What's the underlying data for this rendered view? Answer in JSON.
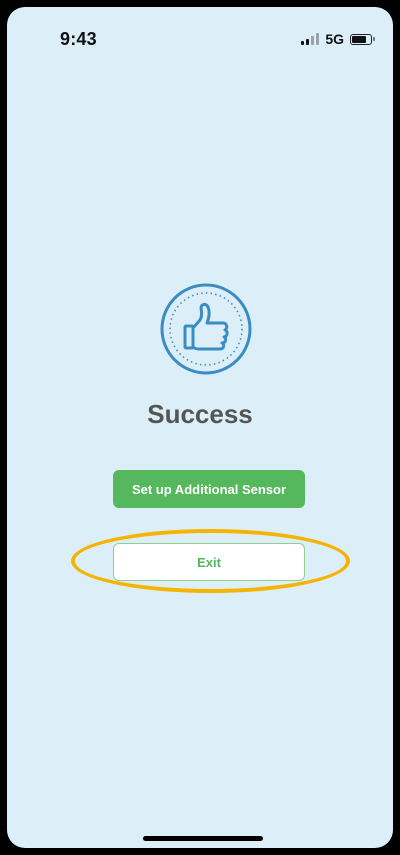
{
  "status_bar": {
    "time": "9:43",
    "network": "5G",
    "signal_bars_active": 2,
    "signal_bars_total": 4,
    "battery_level": 0.8
  },
  "main": {
    "icon": "thumbs-up-icon",
    "title": "Success",
    "primary_button_label": "Set up Additional Sensor",
    "secondary_button_label": "Exit"
  },
  "colors": {
    "background": "#DCEFF9",
    "accent_green": "#55B85C",
    "icon_blue": "#3C8CC4",
    "title_gray": "#555555",
    "highlight_ring": "#F5B400"
  }
}
